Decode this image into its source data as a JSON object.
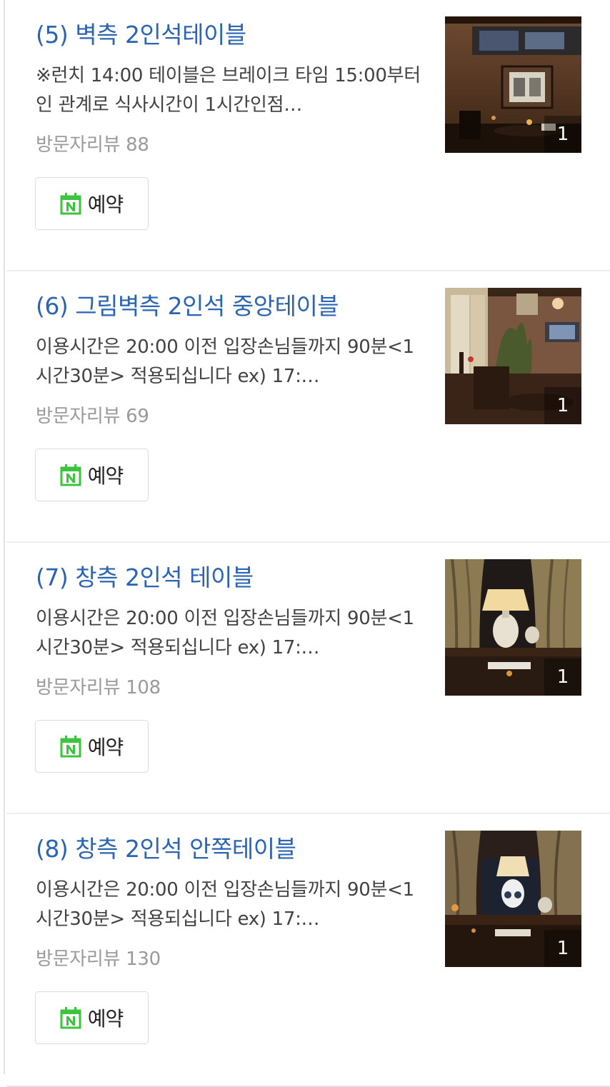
{
  "items": [
    {
      "title": "(5) 벽측 2인석테이블",
      "description": "※런치 14:00 테이블은 브레이크 타임 15:00부터인 관계로 식사시간이 1시간인점…",
      "review_label": "방문자리뷰",
      "review_count": "88",
      "reserve_label": "예약",
      "photo_count": "1"
    },
    {
      "title": "(6) 그림벽측 2인석 중앙테이블",
      "description": "이용시간은 20:00 이전 입장손님들까지 90분<1시간30분> 적용되십니다 ex) 17:…",
      "review_label": "방문자리뷰",
      "review_count": "69",
      "reserve_label": "예약",
      "photo_count": "1"
    },
    {
      "title": "(7) 창측 2인석 테이블",
      "description": "이용시간은 20:00 이전 입장손님들까지 90분<1시간30분> 적용되십니다 ex) 17:…",
      "review_label": "방문자리뷰",
      "review_count": "108",
      "reserve_label": "예약",
      "photo_count": "1"
    },
    {
      "title": "(8) 창측 2인석 안쪽테이블",
      "description": "이용시간은 20:00 이전 입장손님들까지 90분<1시간30분> 적용되십니다 ex) 17:…",
      "review_label": "방문자리뷰",
      "review_count": "130",
      "reserve_label": "예약",
      "photo_count": "1"
    }
  ],
  "colors": {
    "title": "#2a64b2",
    "naver_green": "#3ec33e",
    "review_gray": "#9a9a9a"
  },
  "icons": {
    "reserve": "naver-booking-calendar-icon"
  }
}
